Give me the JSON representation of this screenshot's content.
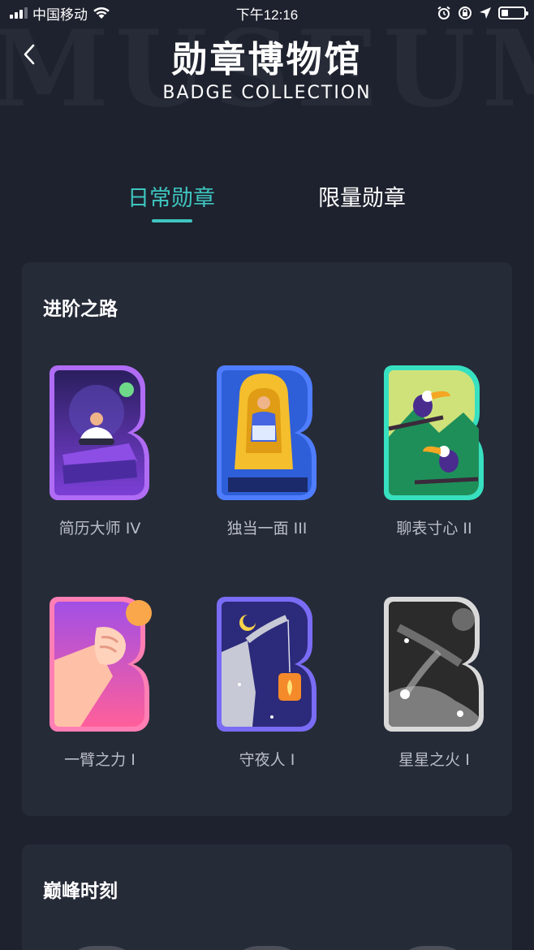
{
  "status_bar": {
    "carrier": "中国移动",
    "time": "下午12:16",
    "battery_level": 0.3
  },
  "header": {
    "background_text": "MUSEUM",
    "title": "勋章博物馆",
    "subtitle": "BADGE COLLECTION",
    "back_icon": "chevron-left-icon"
  },
  "tabs": [
    {
      "label": "日常勋章",
      "active": true
    },
    {
      "label": "限量勋章",
      "active": false
    }
  ],
  "sections": [
    {
      "title": "进阶之路",
      "badges": [
        {
          "label": "简历大师 IV",
          "icon": "meditating-man-badge",
          "colors": [
            "#a25cf0",
            "#5b2aa8"
          ]
        },
        {
          "label": "独当一面 III",
          "icon": "man-on-armchair-badge",
          "colors": [
            "#3b6fe0",
            "#f2b52a"
          ]
        },
        {
          "label": "聊表寸心 II",
          "icon": "toucans-badge",
          "colors": [
            "#2fd3b9",
            "#1f8a5a"
          ]
        },
        {
          "label": "一臂之力 I",
          "icon": "raised-fist-badge",
          "colors": [
            "#ff6fa5",
            "#9b3bd8"
          ]
        },
        {
          "label": "守夜人 I",
          "icon": "night-watchman-lantern-badge",
          "colors": [
            "#6b5cf0",
            "#2a2470"
          ]
        },
        {
          "label": "星星之火 I",
          "icon": "shooting-stars-badge",
          "colors": [
            "#cfcfcf",
            "#333333"
          ]
        }
      ]
    },
    {
      "title": "巅峰时刻",
      "badges": []
    }
  ],
  "colors": {
    "background": "#1e222e",
    "card": "#262b38",
    "accent": "#3ec6c0",
    "label": "#b9bdc6"
  }
}
